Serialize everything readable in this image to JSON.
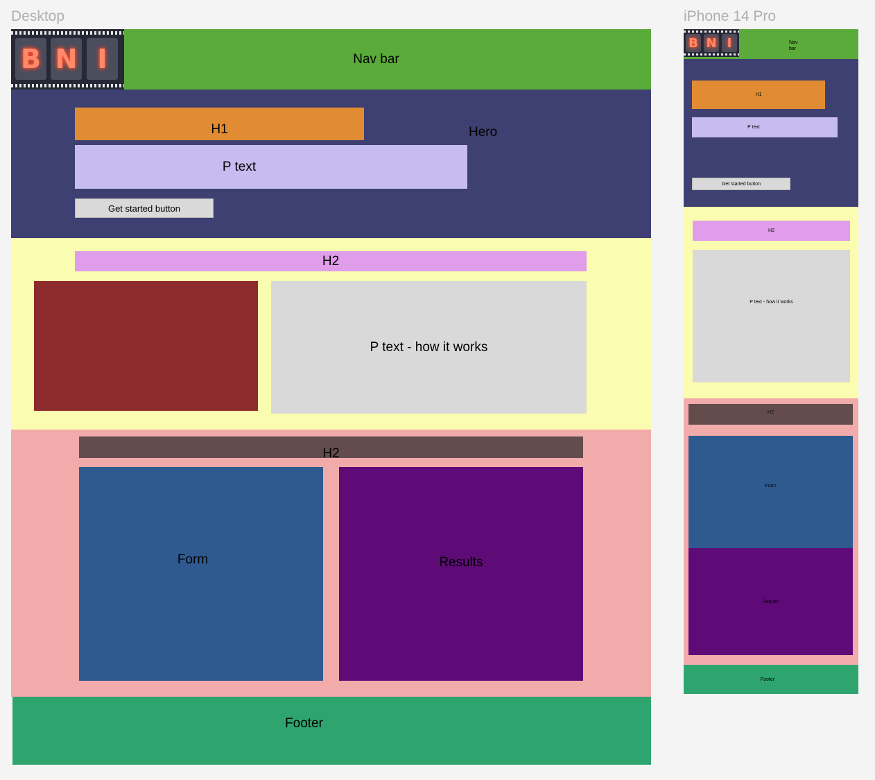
{
  "desktop": {
    "frame_title": "Desktop",
    "logo": {
      "letters": [
        "B",
        "N",
        "I"
      ]
    },
    "nav_label": "Nav bar",
    "hero": {
      "label": "Hero",
      "h1": "H1",
      "p_text": "P text",
      "button": "Get started button"
    },
    "how_it_works": {
      "h2": "H2",
      "p_text": "P text - how it works"
    },
    "calculator": {
      "h2": "H2",
      "form": "Form",
      "results": "Results"
    },
    "footer": "Footer"
  },
  "mobile": {
    "frame_title": "iPhone 14 Pro",
    "logo": {
      "letters": [
        "B",
        "N",
        "I"
      ]
    },
    "nav_label": "Nav\nbar",
    "hero": {
      "h1": "H1",
      "p_text": "P text",
      "button": "Get started button"
    },
    "how_it_works": {
      "h2": "H2",
      "p_text": "P text - how it works"
    },
    "calculator": {
      "h2": "H2",
      "form": "Form",
      "results": "Results"
    },
    "footer": "Footer"
  },
  "colors": {
    "canvas": "#f4f4f4",
    "nav": "#5aab3a",
    "hero": "#3d4070",
    "h1": "#e18c33",
    "p_text": "#c7bcf0",
    "button": "#d9d9d9",
    "how_section": "#fafcaf",
    "h2_how": "#e09dea",
    "image": "#8c2b2b",
    "p_how": "#d9d9d9",
    "calc_section": "#f2abab",
    "h2_calc": "#644c4c",
    "form": "#2f5a8f",
    "results": "#5e0b77",
    "footer": "#2ea46e"
  }
}
